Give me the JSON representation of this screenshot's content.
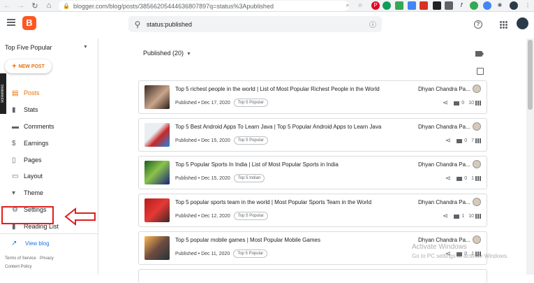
{
  "browser": {
    "url": "blogger.com/blog/posts/38566205444636807897q=status%3Apublished"
  },
  "header": {
    "search_value": "status:published"
  },
  "sidebar": {
    "blog_name": "Top Five Popular",
    "new_post_label": "NEW POST",
    "screenrec_label": "screenrec",
    "items": [
      {
        "label": "Posts",
        "icon": "posts-icon",
        "active": true
      },
      {
        "label": "Stats",
        "icon": "stats-icon"
      },
      {
        "label": "Comments",
        "icon": "comments-icon"
      },
      {
        "label": "Earnings",
        "icon": "dollar-icon"
      },
      {
        "label": "Pages",
        "icon": "pages-icon"
      },
      {
        "label": "Layout",
        "icon": "layout-icon"
      },
      {
        "label": "Theme",
        "icon": "theme-icon"
      },
      {
        "label": "Settings",
        "icon": "gear-icon"
      },
      {
        "label": "Reading List",
        "icon": "bookmark-icon"
      }
    ],
    "view_blog": "View blog",
    "terms": "Terms of Service",
    "privacy": "Privacy",
    "content_policy": "Content Policy"
  },
  "main": {
    "filter_label": "Published (20)",
    "posts": [
      {
        "title": "Top 5 richest people in the world | List of Most Popular Richest People in the World",
        "status": "Published",
        "date": "Dec 17, 2020",
        "tag": "Top 5 Popular",
        "author": "Dhyan Chandra Pa...",
        "comments": "0",
        "views": "10"
      },
      {
        "title": "Top 5 Best Android Apps To Learn Java | Top 5 Popular Android Apps to Learn Java",
        "status": "Published",
        "date": "Dec 15, 2020",
        "tag": "Top 5 Popular",
        "author": "Dhyan Chandra Pa...",
        "comments": "0",
        "views": "7"
      },
      {
        "title": "Top 5 Popular Sports In India | List of Most Popular Sports in India",
        "status": "Published",
        "date": "Dec 15, 2020",
        "tag": "Top 5 Indian",
        "author": "Dhyan Chandra Pa...",
        "comments": "0",
        "views": "1"
      },
      {
        "title": "Top 5 popular sports team in the world | Most Popular Sports Team in the World",
        "status": "Published",
        "date": "Dec 12, 2020",
        "tag": "Top 5 Popular",
        "author": "Dhyan Chandra Pa...",
        "comments": "1",
        "views": "10"
      },
      {
        "title": "Top 5 popular mobile games | Most Popular Mobile Games",
        "status": "Published",
        "date": "Dec 11, 2020",
        "tag": "Top 5 Popular",
        "author": "Dhyan Chandra Pa...",
        "comments": "0",
        "views": "1"
      }
    ]
  },
  "watermark": {
    "line1": "Activate Windows",
    "line2": "Go to PC settings to activate Windows."
  },
  "colors": {
    "accent": "#e8710a",
    "blogger_logo": "#ff5722",
    "annotation": "#e01e1e"
  }
}
